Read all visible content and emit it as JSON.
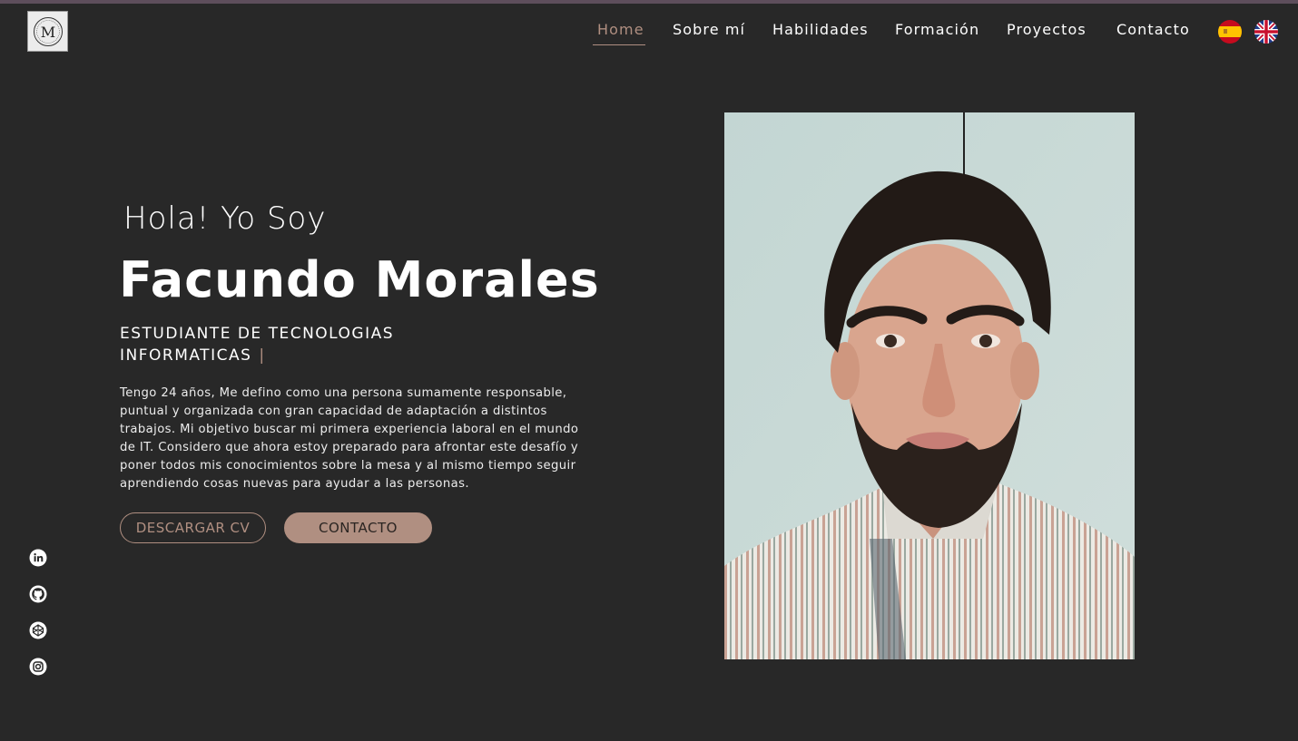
{
  "header": {
    "logo_text": "M",
    "nav": [
      {
        "label": "Home",
        "active": true
      },
      {
        "label": "Sobre mí",
        "active": false
      },
      {
        "label": "Habilidades",
        "active": false
      },
      {
        "label": "Formación",
        "active": false
      },
      {
        "label": "Proyectos",
        "active": false
      },
      {
        "label": "Contacto",
        "active": false
      }
    ],
    "languages": [
      {
        "icon": "spain-flag-icon",
        "code": "es"
      },
      {
        "icon": "uk-flag-icon",
        "code": "en"
      }
    ]
  },
  "hero": {
    "greeting": "Hola! Yo Soy",
    "name": "Facundo Morales",
    "role": "ESTUDIANTE DE TECNOLOGIAS INFORMATICAS",
    "cursor": "|",
    "bio": "Tengo 24 años, Me defino como una persona sumamente responsable, puntual y organizada con gran capacidad de adaptación a distintos trabajos. Mi objetivo buscar mi primera experiencia laboral en el mundo de IT. Considero que ahora estoy preparado para afrontar este desafío y poner todos mis conocimientos sobre la mesa y al mismo tiempo seguir aprendiendo cosas nuevas para ayudar a las personas.",
    "buttons": {
      "cv": "DESCARGAR CV",
      "contact": "CONTACTO"
    }
  },
  "social": [
    {
      "icon": "linkedin-icon"
    },
    {
      "icon": "github-icon"
    },
    {
      "icon": "codepen-icon"
    },
    {
      "icon": "instagram-icon"
    }
  ],
  "colors": {
    "background": "#282828",
    "accent": "#b08f81",
    "text": "#ffffff"
  }
}
